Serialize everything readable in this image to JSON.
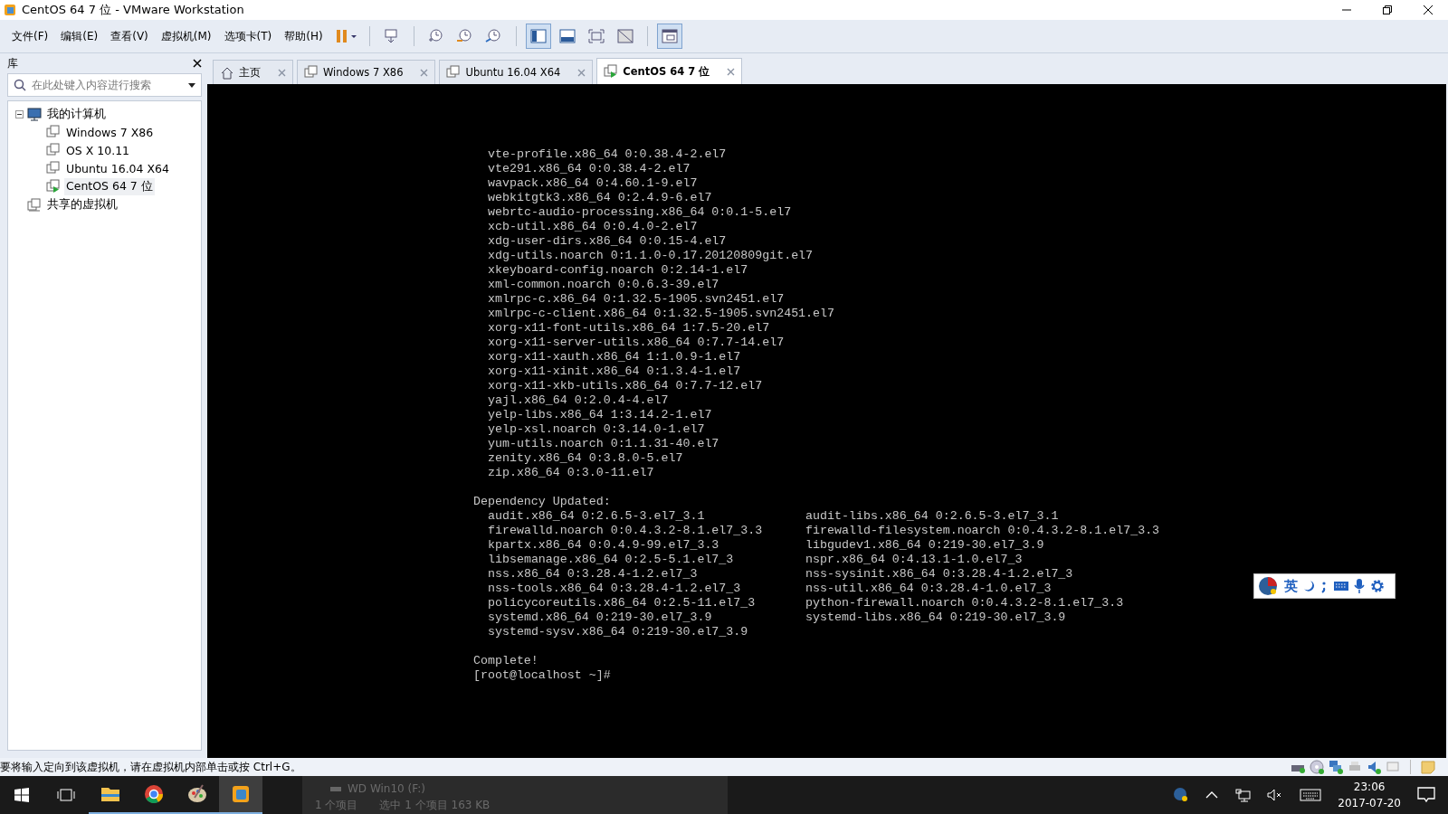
{
  "window": {
    "title": "CentOS 64 7 位 - VMware Workstation"
  },
  "menu": [
    "文件(F)",
    "编辑(E)",
    "查看(V)",
    "虚拟机(M)",
    "选项卡(T)",
    "帮助(H)"
  ],
  "toolbar": [
    {
      "kind": "pause",
      "selected": false
    },
    {
      "kind": "sep"
    },
    {
      "kind": "send",
      "selected": false
    },
    {
      "kind": "sep"
    },
    {
      "kind": "snap",
      "selected": false
    },
    {
      "kind": "revert",
      "selected": false
    },
    {
      "kind": "manage",
      "selected": false
    },
    {
      "kind": "sep"
    },
    {
      "kind": "library",
      "selected": true
    },
    {
      "kind": "thumb",
      "selected": false
    },
    {
      "kind": "full",
      "selected": false
    },
    {
      "kind": "unity",
      "selected": false
    },
    {
      "kind": "sep"
    },
    {
      "kind": "console",
      "selected": true
    }
  ],
  "library": {
    "title": "库",
    "search": {
      "placeholder": "在此处键入内容进行搜索"
    },
    "tree": [
      {
        "label": "我的计算机",
        "kind": "computer",
        "expanded": true,
        "selected": false,
        "children": [
          {
            "label": "Windows 7 X86",
            "kind": "vm",
            "running": false,
            "selected": false
          },
          {
            "label": "OS X 10.11",
            "kind": "vm",
            "running": false,
            "selected": false
          },
          {
            "label": "Ubuntu 16.04 X64",
            "kind": "vm",
            "running": false,
            "selected": false
          },
          {
            "label": "CentOS 64 7 位",
            "kind": "vm",
            "running": true,
            "selected": true
          }
        ]
      },
      {
        "label": "共享的虚拟机",
        "kind": "shared",
        "selected": false
      }
    ]
  },
  "tabs": [
    {
      "label": "主页",
      "kind": "home",
      "selected": false
    },
    {
      "label": "Windows 7 X86",
      "kind": "vm",
      "selected": false
    },
    {
      "label": "Ubuntu 16.04 X64",
      "kind": "vm",
      "selected": false
    },
    {
      "label": "CentOS 64 7 位",
      "kind": "running_vm",
      "selected": true
    }
  ],
  "console": {
    "packages": [
      "vte-profile.x86_64 0:0.38.4-2.el7",
      "vte291.x86_64 0:0.38.4-2.el7",
      "wavpack.x86_64 0:4.60.1-9.el7",
      "webkitgtk3.x86_64 0:2.4.9-6.el7",
      "webrtc-audio-processing.x86_64 0:0.1-5.el7",
      "xcb-util.x86_64 0:0.4.0-2.el7",
      "xdg-user-dirs.x86_64 0:0.15-4.el7",
      "xdg-utils.noarch 0:1.1.0-0.17.20120809git.el7",
      "xkeyboard-config.noarch 0:2.14-1.el7",
      "xml-common.noarch 0:0.6.3-39.el7",
      "xmlrpc-c.x86_64 0:1.32.5-1905.svn2451.el7",
      "xmlrpc-c-client.x86_64 0:1.32.5-1905.svn2451.el7",
      "xorg-x11-font-utils.x86_64 1:7.5-20.el7",
      "xorg-x11-server-utils.x86_64 0:7.7-14.el7",
      "xorg-x11-xauth.x86_64 1:1.0.9-1.el7",
      "xorg-x11-xinit.x86_64 0:1.3.4-1.el7",
      "xorg-x11-xkb-utils.x86_64 0:7.7-12.el7",
      "yajl.x86_64 0:2.0.4-4.el7",
      "yelp-libs.x86_64 1:3.14.2-1.el7",
      "yelp-xsl.noarch 0:3.14.0-1.el7",
      "yum-utils.noarch 0:1.1.31-40.el7",
      "zenity.x86_64 0:3.8.0-5.el7",
      "zip.x86_64 0:3.0-11.el7"
    ],
    "dependency_heading": "Dependency Updated:",
    "dependencies": [
      [
        "audit.x86_64 0:2.6.5-3.el7_3.1",
        "audit-libs.x86_64 0:2.6.5-3.el7_3.1"
      ],
      [
        "firewalld.noarch 0:0.4.3.2-8.1.el7_3.3",
        "firewalld-filesystem.noarch 0:0.4.3.2-8.1.el7_3.3"
      ],
      [
        "kpartx.x86_64 0:0.4.9-99.el7_3.3",
        "libgudev1.x86_64 0:219-30.el7_3.9"
      ],
      [
        "libsemanage.x86_64 0:2.5-5.1.el7_3",
        "nspr.x86_64 0:4.13.1-1.0.el7_3"
      ],
      [
        "nss.x86_64 0:3.28.4-1.2.el7_3",
        "nss-sysinit.x86_64 0:3.28.4-1.2.el7_3"
      ],
      [
        "nss-tools.x86_64 0:3.28.4-1.2.el7_3",
        "nss-util.x86_64 0:3.28.4-1.0.el7_3"
      ],
      [
        "policycoreutils.x86_64 0:2.5-11.el7_3",
        "python-firewall.noarch 0:0.4.3.2-8.1.el7_3.3"
      ],
      [
        "systemd.x86_64 0:219-30.el7_3.9",
        "systemd-libs.x86_64 0:219-30.el7_3.9"
      ],
      [
        "systemd-sysv.x86_64 0:219-30.el7_3.9"
      ]
    ],
    "complete": "Complete!",
    "prompt": "[root@localhost ~]#"
  },
  "ime_bar": {
    "mode": "英"
  },
  "status_bar": {
    "message": "要将输入定向到该虚拟机，请在虚拟机内部单击或按 Ctrl+G。"
  },
  "background_window": {
    "drive": "WD Win10 (F:)",
    "items": "1 个项目",
    "selection": "选中 1 个项目 163 KB"
  },
  "taskbar": {
    "apps": [
      {
        "kind": "explorer",
        "selected": false
      },
      {
        "kind": "chrome",
        "selected": false
      },
      {
        "kind": "paint",
        "selected": false
      },
      {
        "kind": "vmware",
        "selected": true
      }
    ],
    "time": "23:06",
    "date": "2017-07-20"
  }
}
